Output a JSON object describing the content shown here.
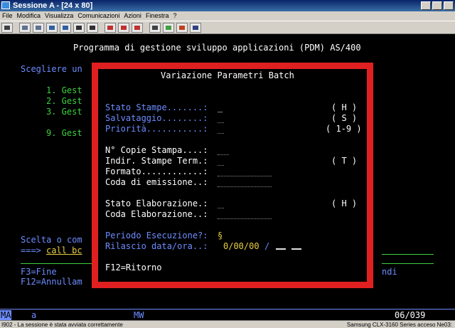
{
  "window": {
    "title": "Sessione A - [24 x 80]"
  },
  "menu": [
    "File",
    "Modifica",
    "Visualizza",
    "Comunicazioni",
    "Azioni",
    "Finestra",
    "?"
  ],
  "toolbar_icons": [
    "print-icon",
    "copy-icon",
    "paste-icon",
    "send-icon",
    "receive-icon",
    "display-icon",
    "keyboard-icon",
    "macro-play-icon",
    "macro-record-icon",
    "macro-stop-icon",
    "setup-icon",
    "color-icon",
    "support-icon",
    "help-icon"
  ],
  "screen": {
    "header": "Programma di gestione sviluppo applicazioni (PDM) AS/400",
    "prompt_left": "Scegliere un",
    "menu_items": [
      "1. Gest",
      "2. Gest",
      "3. Gest",
      "9. Gest"
    ],
    "scelta": "Scelta o com",
    "command_prefix": "===>",
    "command_value": "call bc",
    "f3": "F3=Fine",
    "f12_left": "F12=Annullam",
    "ndi": "ndi"
  },
  "dialog": {
    "title": "Variazione Parametri Batch",
    "fields": [
      {
        "label": "Stato Stampe.......:",
        "value": "_",
        "hint": "( H )"
      },
      {
        "label": "Salvataggio........:",
        "value": "",
        "hint": "( S )"
      },
      {
        "label": "Priorità...........:",
        "value": "",
        "hint": "( 1-9 )"
      },
      {
        "label": "N° Copie Stampa....:",
        "value": "",
        "hint": ""
      },
      {
        "label": "Indir. Stampe Term.:",
        "value": "",
        "hint": "( T )"
      },
      {
        "label": "Formato............:",
        "value": "",
        "hint": ""
      },
      {
        "label": "Coda di emissione..:",
        "value": "",
        "hint": ""
      },
      {
        "label": "Stato Elaborazione.:",
        "value": "",
        "hint": "( H )"
      },
      {
        "label": "Coda Elaborazione..:",
        "value": "",
        "hint": ""
      }
    ],
    "periodo_label": "Periodo Esecuzione?:",
    "periodo_value": "§",
    "rilascio_label": "Rilascio data/ora..:",
    "rilascio_value": "0/00/00",
    "rilascio_sep": "/",
    "f12": "F12=Ritorno"
  },
  "status_line": {
    "left": "MA",
    "mode": "a",
    "mw": "MW",
    "cursor": "06/039"
  },
  "status_bar": {
    "message": "I902 - La sessione è stata avviata correttamente",
    "printer": "Samsung CLX-3160 Series acceso Ne03:"
  },
  "colors": {
    "border": "#e02020",
    "green": "#3cd040",
    "blue": "#6d8cff",
    "yellow": "#e8d040"
  }
}
